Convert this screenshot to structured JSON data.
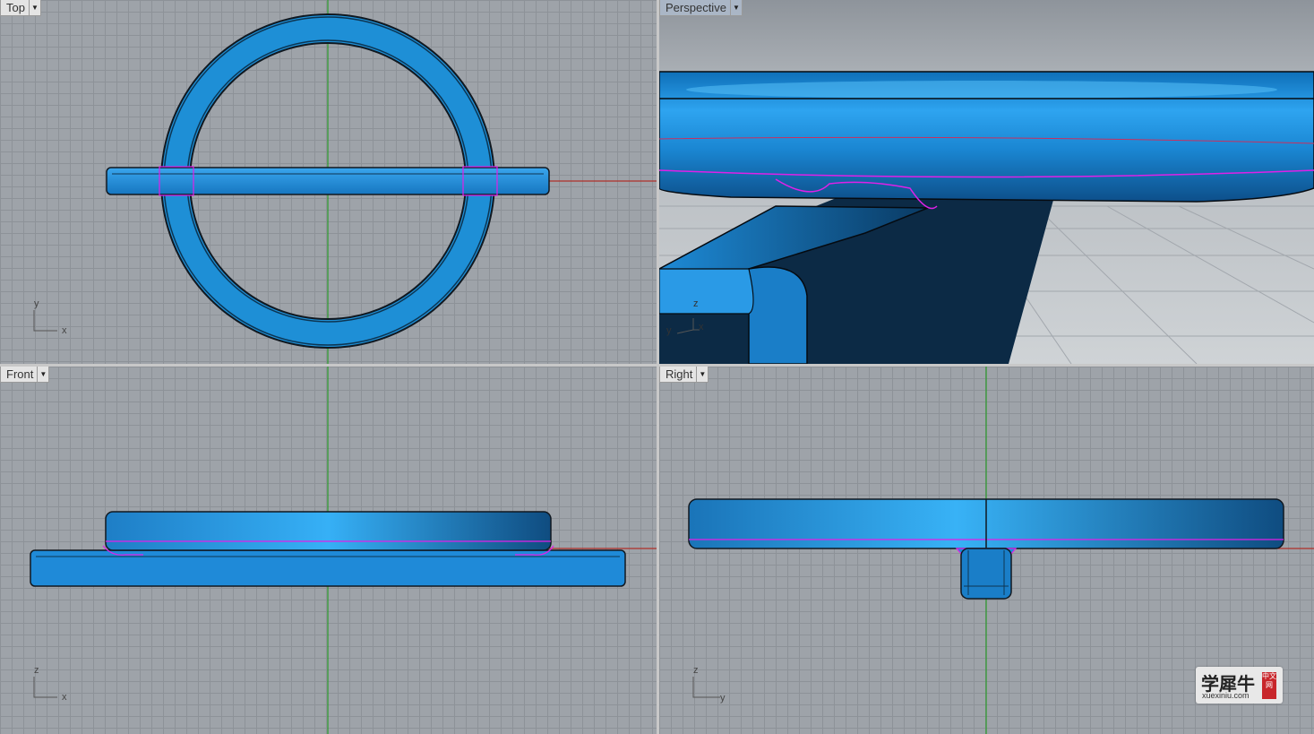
{
  "viewports": {
    "top": {
      "label": "Top",
      "axis_a": "y",
      "axis_b": "x"
    },
    "perspective": {
      "label": "Perspective",
      "axis_a": "z",
      "axis_b": "y",
      "axis_c": "x"
    },
    "front": {
      "label": "Front",
      "axis_a": "z",
      "axis_b": "x"
    },
    "right": {
      "label": "Right",
      "axis_a": "z",
      "axis_b": "y"
    }
  },
  "watermark": {
    "main": "学犀牛",
    "sub": "xuexiniu.com",
    "badge": "中文网"
  },
  "colors": {
    "model_blue": "#1e8fd6",
    "model_edge": "#101820",
    "seam_magenta": "#e020e8",
    "axis_red": "#b0302a",
    "axis_green": "#2a9a2a",
    "grid_bg": "#9ea3a9"
  }
}
